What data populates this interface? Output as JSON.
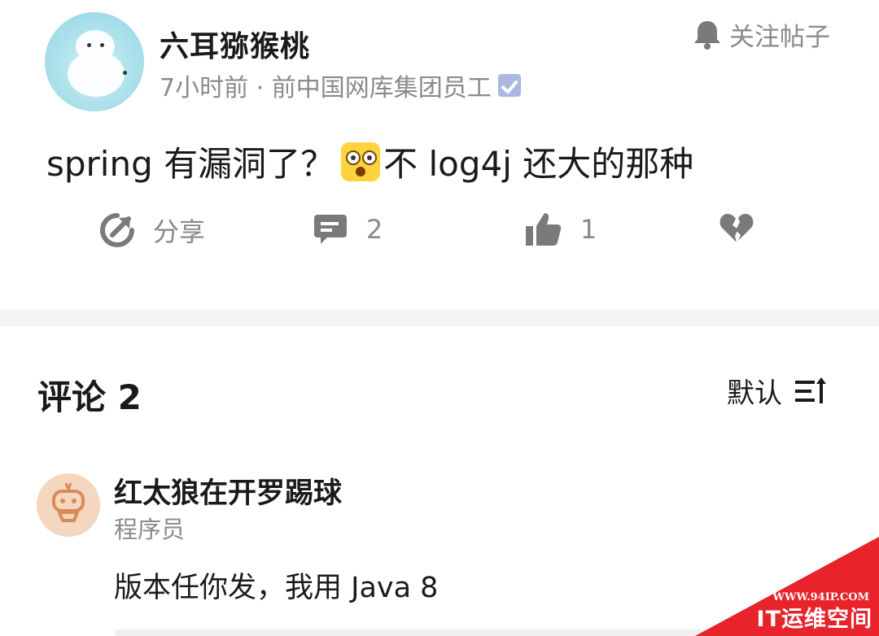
{
  "post": {
    "author_name": "六耳猕猴桃",
    "meta": "7小时前 · 前中国网库集团员工",
    "follow_label": "关注帖子",
    "content_before": "spring 有漏洞了？",
    "content_after": "不 log4j 还大的那种",
    "actions": {
      "share_label": "分享",
      "comment_count": "2",
      "like_count": "1"
    }
  },
  "comments_section": {
    "title": "评论 2",
    "sort_label": "默认"
  },
  "comments": [
    {
      "name": "红太狼在开罗踢球",
      "role": "程序员",
      "text": "版本任你发，我用 Java 8"
    }
  ],
  "watermark": {
    "url": "WWW.94IP.COM",
    "name": "IT运维空间"
  },
  "colors": {
    "icon_gray": "#7a7a7a",
    "watermark_red": "#e8232a",
    "verified_blue": "#a9b8de"
  }
}
